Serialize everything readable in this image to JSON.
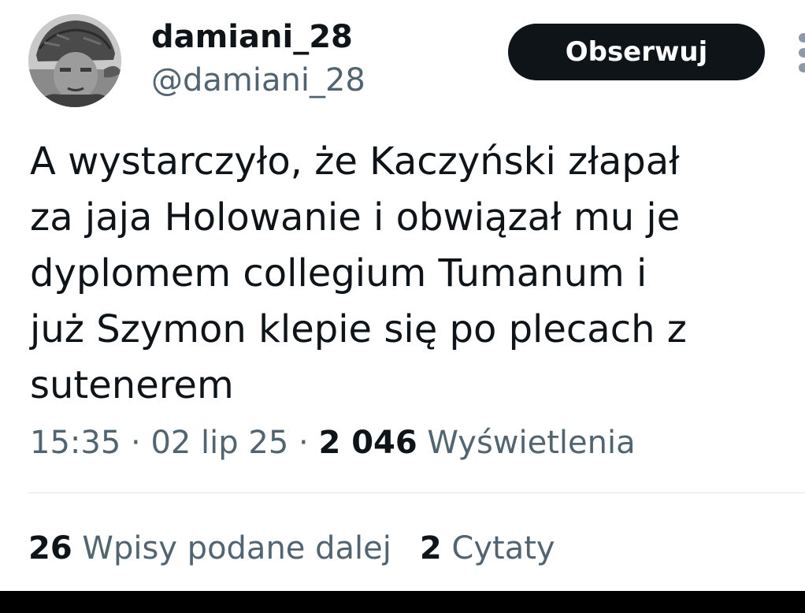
{
  "author": {
    "display_name": "damiani_28",
    "handle": "@damiani_28",
    "avatar_icon": "soldier-portrait-photo"
  },
  "follow_button": {
    "label": "Obserwuj"
  },
  "more_menu": {
    "icon": "more-vertical-icon"
  },
  "tweet": {
    "text_lines": [
      "A wystarczyło, że Kaczyński złapał",
      "za jaja Holowanie i obwiązał mu je",
      "dyplomem collegium Tumanum i",
      "już Szymon klepie się po plecach z",
      "sutenerem"
    ],
    "time": "15:35",
    "date": "02 lip 25",
    "separator": " · ",
    "views_count": "2 046",
    "views_label": "Wyświetlenia"
  },
  "stats": {
    "reposts_count": "26",
    "reposts_label": "Wpisy podane dalej",
    "quotes_count": "2",
    "quotes_label": "Cytaty"
  },
  "colors": {
    "primary_text": "#0f1419",
    "secondary_text": "#536471",
    "follow_bg": "#0f1419",
    "divider": "#e1e6ea"
  }
}
